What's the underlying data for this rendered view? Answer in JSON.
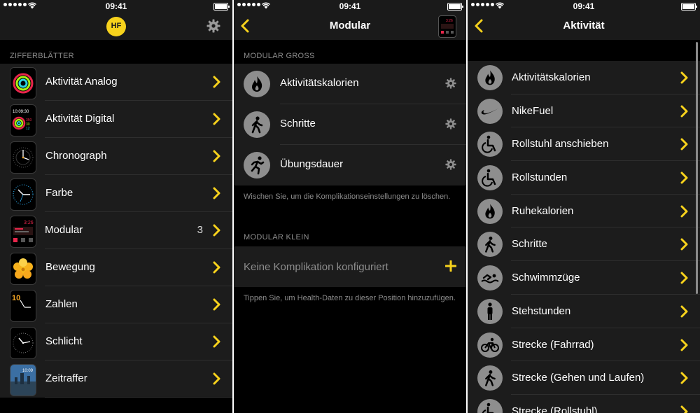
{
  "status": {
    "time": "09:41"
  },
  "colors": {
    "accent": "#f7d21c",
    "background": "#000000",
    "cell": "#1c1c1c",
    "secondary_text": "#8d8d8d"
  },
  "panel1": {
    "logo_text": "HF",
    "section": "ZIFFERBLÄTTER",
    "faces": [
      {
        "label": "Aktivität Analog",
        "icon": "activity-analog-face"
      },
      {
        "label": "Aktivität Digital",
        "icon": "activity-digital-face",
        "thumb_time": "10:09:30",
        "thumb_stats": [
          "350",
          "30",
          "12"
        ]
      },
      {
        "label": "Chronograph",
        "icon": "chronograph-face"
      },
      {
        "label": "Farbe",
        "icon": "color-face"
      },
      {
        "label": "Modular",
        "icon": "modular-face",
        "count": "3",
        "thumb_time": "3:26"
      },
      {
        "label": "Bewegung",
        "icon": "motion-face"
      },
      {
        "label": "Zahlen",
        "icon": "numerals-face",
        "thumb_number": "10"
      },
      {
        "label": "Schlicht",
        "icon": "simple-face"
      },
      {
        "label": "Zeitraffer",
        "icon": "timelapse-face",
        "thumb_time": "10:09"
      }
    ]
  },
  "panel2": {
    "title": "Modular",
    "thumb_time": "3:26",
    "section_large": "MODULAR GROSS",
    "complications": [
      {
        "label": "Aktivitätskalorien",
        "icon": "flame-icon"
      },
      {
        "label": "Schritte",
        "icon": "walking-icon"
      },
      {
        "label": "Übungsdauer",
        "icon": "running-icon"
      }
    ],
    "swipe_hint": "Wischen Sie, um die Komplikationseinstellungen zu löschen.",
    "section_small": "MODULAR KLEIN",
    "empty_label": "Keine Komplikation konfiguriert",
    "tap_hint": "Tippen Sie, um Health-Daten zu dieser Position hinzuzufügen."
  },
  "panel3": {
    "title": "Aktivität",
    "items": [
      {
        "label": "Aktivitätskalorien",
        "icon": "flame-icon"
      },
      {
        "label": "NikeFuel",
        "icon": "swoosh-icon"
      },
      {
        "label": "Rollstuhl anschieben",
        "icon": "wheelchair-icon"
      },
      {
        "label": "Rollstunden",
        "icon": "wheelchair-icon"
      },
      {
        "label": "Ruhekalorien",
        "icon": "flame-icon"
      },
      {
        "label": "Schritte",
        "icon": "walking-icon"
      },
      {
        "label": "Schwimmzüge",
        "icon": "swimming-icon"
      },
      {
        "label": "Stehstunden",
        "icon": "standing-icon"
      },
      {
        "label": "Strecke (Fahrrad)",
        "icon": "bicycle-icon"
      },
      {
        "label": "Strecke (Gehen und Laufen)",
        "icon": "walking-icon"
      },
      {
        "label": "Strecke (Rollstuhl)",
        "icon": "wheelchair-icon"
      }
    ]
  }
}
